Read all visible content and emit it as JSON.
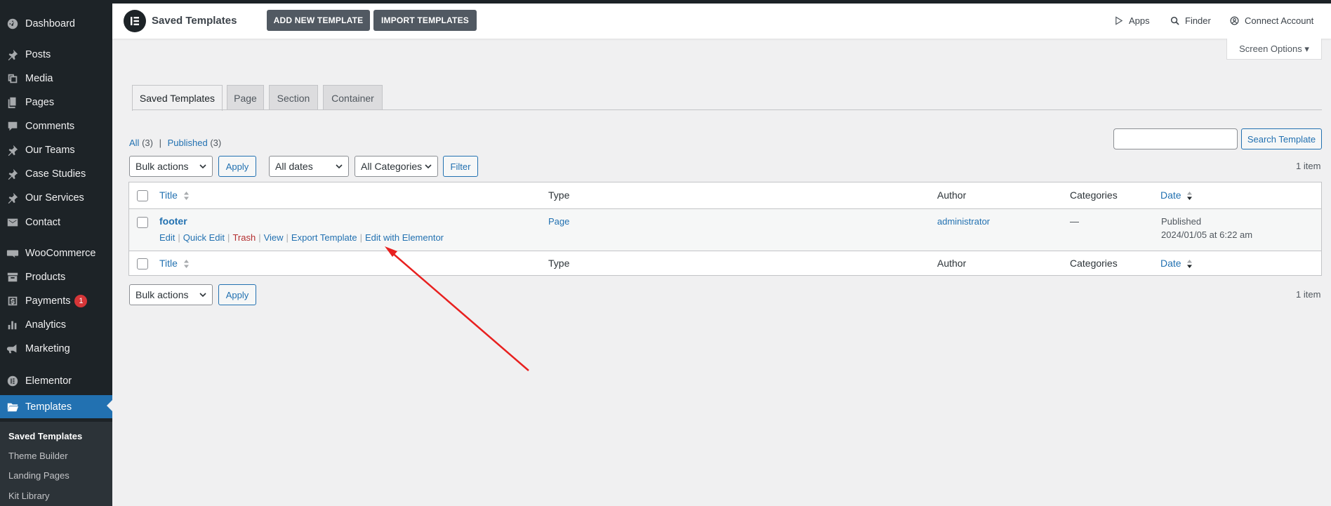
{
  "sidebar": {
    "items": [
      {
        "name": "dashboard",
        "label": "Dashboard",
        "icon": "dashboard-icon"
      },
      {
        "name": "posts",
        "label": "Posts",
        "icon": "pin-icon"
      },
      {
        "name": "media",
        "label": "Media",
        "icon": "media-icon"
      },
      {
        "name": "pages",
        "label": "Pages",
        "icon": "pages-icon"
      },
      {
        "name": "comments",
        "label": "Comments",
        "icon": "comment-icon"
      },
      {
        "name": "our-teams",
        "label": "Our Teams",
        "icon": "pin-icon"
      },
      {
        "name": "case-studies",
        "label": "Case Studies",
        "icon": "pin-icon"
      },
      {
        "name": "our-services",
        "label": "Our Services",
        "icon": "pin-icon"
      },
      {
        "name": "contact",
        "label": "Contact",
        "icon": "mail-icon"
      },
      {
        "name": "woocommerce",
        "label": "WooCommerce",
        "icon": "woo-icon"
      },
      {
        "name": "products",
        "label": "Products",
        "icon": "archive-icon"
      },
      {
        "name": "payments",
        "label": "Payments",
        "icon": "dollar-icon",
        "badge": "1"
      },
      {
        "name": "analytics",
        "label": "Analytics",
        "icon": "bar-chart-icon"
      },
      {
        "name": "marketing",
        "label": "Marketing",
        "icon": "megaphone-icon"
      },
      {
        "name": "elementor",
        "label": "Elementor",
        "icon": "elementor-icon"
      },
      {
        "name": "templates",
        "label": "Templates",
        "icon": "folder-icon"
      }
    ],
    "submenu": [
      "Saved Templates",
      "Theme Builder",
      "Landing Pages",
      "Kit Library"
    ]
  },
  "topbar": {
    "title": "Saved Templates",
    "add_new": "ADD NEW TEMPLATE",
    "import": "IMPORT TEMPLATES",
    "apps": "Apps",
    "finder": "Finder",
    "connect": "Connect Account"
  },
  "screen_options": "Screen Options ▾",
  "tabs": [
    "Saved Templates",
    "Page",
    "Section",
    "Container"
  ],
  "filters": {
    "all": "All",
    "all_count": "(3)",
    "published": "Published",
    "published_count": "(3)",
    "sep": "|",
    "search_button": "Search Template",
    "bulk_actions": "Bulk actions",
    "apply": "Apply",
    "all_dates": "All dates",
    "all_categories": "All Categories",
    "filter": "Filter",
    "items_count": "1 item"
  },
  "table": {
    "columns": [
      "Title",
      "Type",
      "Author",
      "Categories",
      "Date"
    ],
    "rows": [
      {
        "title": "footer",
        "type": "Page",
        "author": "administrator",
        "categories": "—",
        "status": "Published",
        "date": "2024/01/05 at 6:22 am",
        "actions": [
          "Edit",
          "Quick Edit",
          "Trash",
          "View",
          "Export Template",
          "Edit with Elementor"
        ]
      }
    ]
  },
  "colors": {
    "sidebar_bg": "#1d2327",
    "accent": "#2271b1",
    "trash": "#b32d2e",
    "badge": "#d63638",
    "annotation_arrow": "#e8201f"
  }
}
